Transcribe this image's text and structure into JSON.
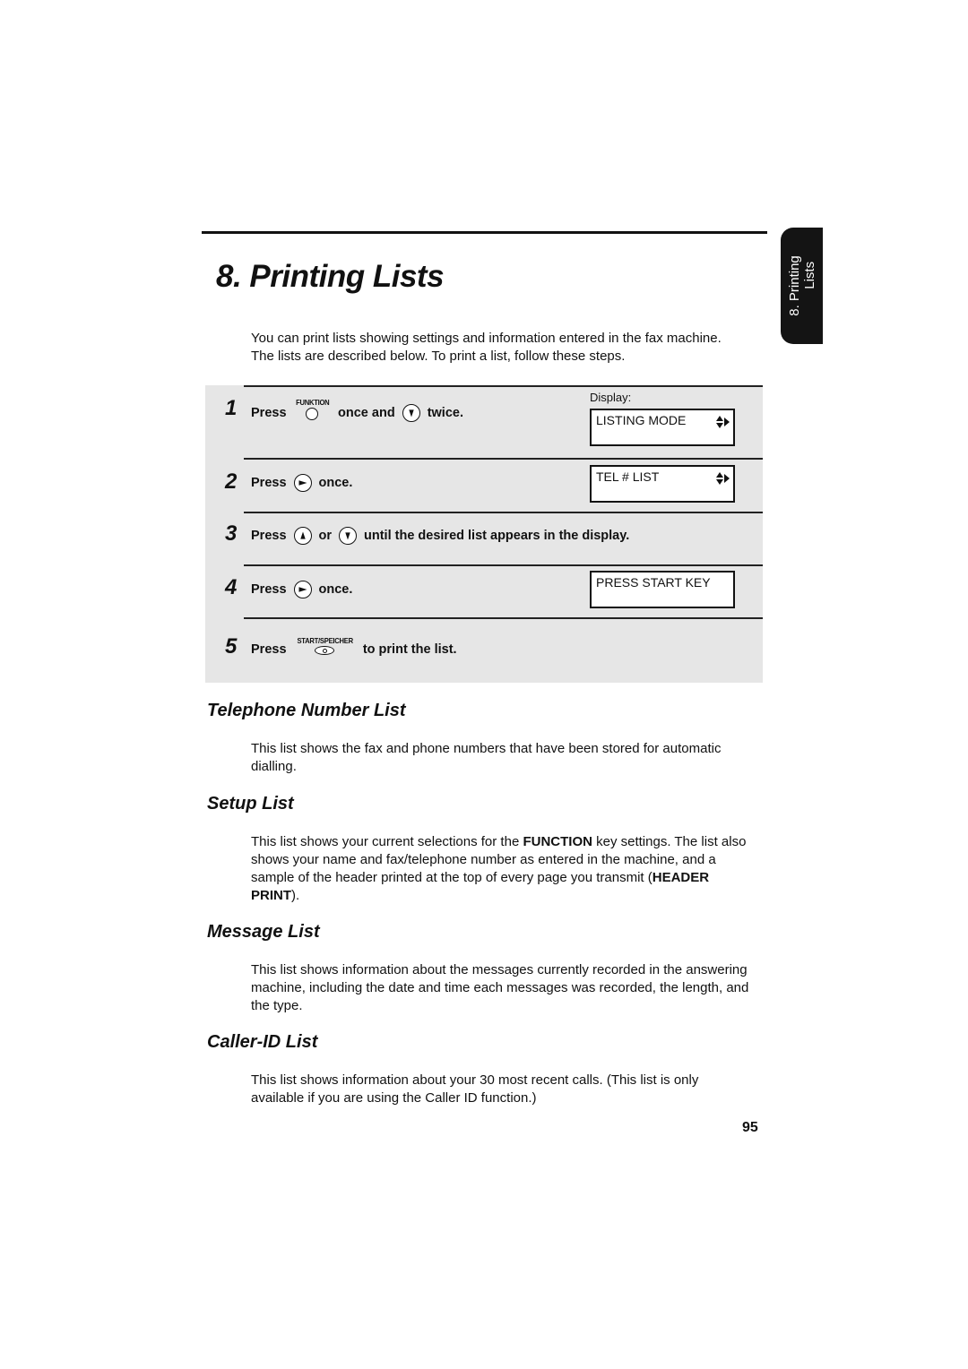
{
  "chapter": {
    "title": "8.  Printing Lists",
    "side_tab": {
      "line1": "8. Printing",
      "line2": "Lists"
    },
    "intro": "You can print lists showing settings and information entered in the fax machine. The lists are described below. To print a list, follow these steps."
  },
  "steps": [
    {
      "number": "1",
      "parts": {
        "press": "Press",
        "key1_label": "FUNKTION",
        "mid": "once and",
        "end": "twice."
      },
      "icons": [
        "function-key-icon",
        "down-arrow-key-icon"
      ]
    },
    {
      "number": "2",
      "parts": {
        "press": "Press",
        "end": "once."
      },
      "icons": [
        "right-arrow-key-icon"
      ]
    },
    {
      "number": "3",
      "parts": {
        "press": "Press",
        "mid": "or",
        "end": "until the desired list appears in the display."
      },
      "icons": [
        "up-arrow-key-icon",
        "down-arrow-key-icon"
      ]
    },
    {
      "number": "4",
      "parts": {
        "press": "Press",
        "end": "once."
      },
      "icons": [
        "right-arrow-key-icon"
      ]
    },
    {
      "number": "5",
      "parts": {
        "press": "Press",
        "key1_label": "START/SPEICHER",
        "end": "to print the list."
      },
      "icons": [
        "start-key-icon"
      ]
    }
  ],
  "display": {
    "label": "Display:",
    "screens": [
      "LISTING MODE",
      "TEL # LIST",
      "PRESS START KEY"
    ]
  },
  "sections": [
    {
      "heading": "Telephone Number List",
      "text": "This list shows the fax and phone numbers that have been stored for automatic dialling."
    },
    {
      "heading": "Setup List",
      "text_parts": [
        "This list shows your current selections for the ",
        "FUNCTION",
        " key settings. The list also shows your name and fax/telephone number as entered in the machine, and a sample of the header printed at the top of every page you transmit (",
        "HEADER PRINT",
        ")."
      ]
    },
    {
      "heading": "Message List",
      "text": "This list shows information about the messages currently recorded in the answering machine, including the date and time each messages was recorded, the length, and the type."
    },
    {
      "heading": "Caller-ID List",
      "text": "This list shows information about your 30 most recent calls. (This list is only available if you are using the Caller ID function.)"
    }
  ],
  "page_number": "95"
}
